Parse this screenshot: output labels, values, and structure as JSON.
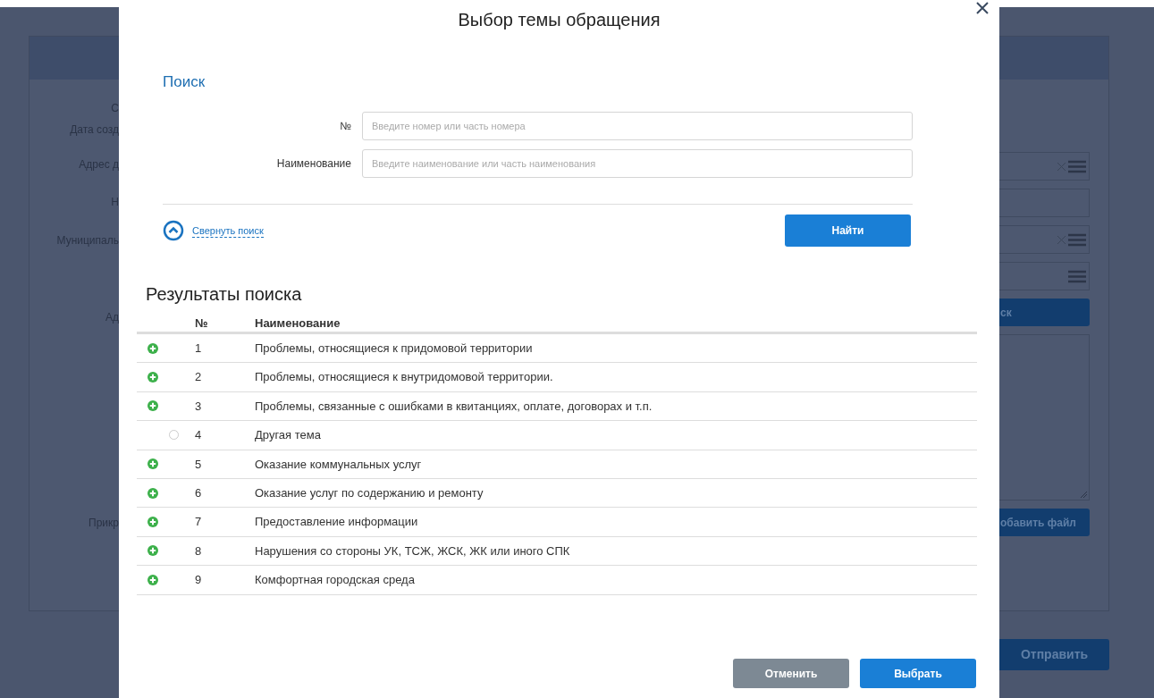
{
  "background_form": {
    "left_labels": [
      "С",
      "Дата созд",
      "Адрес д",
      "Н",
      "Муниципаль",
      "Ад",
      "Прикр"
    ],
    "right_controls": [
      {
        "kind": "select_clear"
      },
      {
        "kind": "input"
      },
      {
        "kind": "select_clear"
      },
      {
        "kind": "select"
      },
      {
        "kind": "button",
        "label": "ск"
      },
      {
        "kind": "textarea"
      },
      {
        "kind": "button",
        "label": "обавить файл"
      }
    ],
    "submit_button": "Отправить"
  },
  "modal": {
    "title": "Выбор темы обращения",
    "search": {
      "heading": "Поиск",
      "fields": [
        {
          "label": "№",
          "placeholder": "Введите номер или часть номера"
        },
        {
          "label": "Наименование",
          "placeholder": "Введите наименование или часть наименования"
        }
      ],
      "collapse_link": "Свернуть поиск",
      "find_button": "Найти"
    },
    "results": {
      "heading": "Результаты поиска",
      "columns": [
        "№",
        "Наименование"
      ],
      "rows": [
        {
          "kind": "group",
          "number": "1",
          "name": "Проблемы, относящиеся к придомовой территории"
        },
        {
          "kind": "group",
          "number": "2",
          "name": "Проблемы, относящиеся к внутридомовой территории."
        },
        {
          "kind": "group",
          "number": "3",
          "name": "Проблемы, связанные с ошибками в квитанциях, оплате, договорах и т.п."
        },
        {
          "kind": "leaf",
          "number": "4",
          "name": "Другая тема",
          "selected": false
        },
        {
          "kind": "group",
          "number": "5",
          "name": "Оказание коммунальных услуг"
        },
        {
          "kind": "group",
          "number": "6",
          "name": "Оказание услуг по содержанию и ремонту"
        },
        {
          "kind": "group",
          "number": "7",
          "name": "Предоставление информации"
        },
        {
          "kind": "group",
          "number": "8",
          "name": "Нарушения со стороны УК, ТСЖ, ЖСК, ЖК или иного СПК"
        },
        {
          "kind": "group",
          "number": "9",
          "name": "Комфортная городская среда"
        }
      ]
    },
    "buttons": [
      {
        "kind": "secondary",
        "label": "Отменить"
      },
      {
        "kind": "primary",
        "label": "Выбрать"
      }
    ]
  }
}
